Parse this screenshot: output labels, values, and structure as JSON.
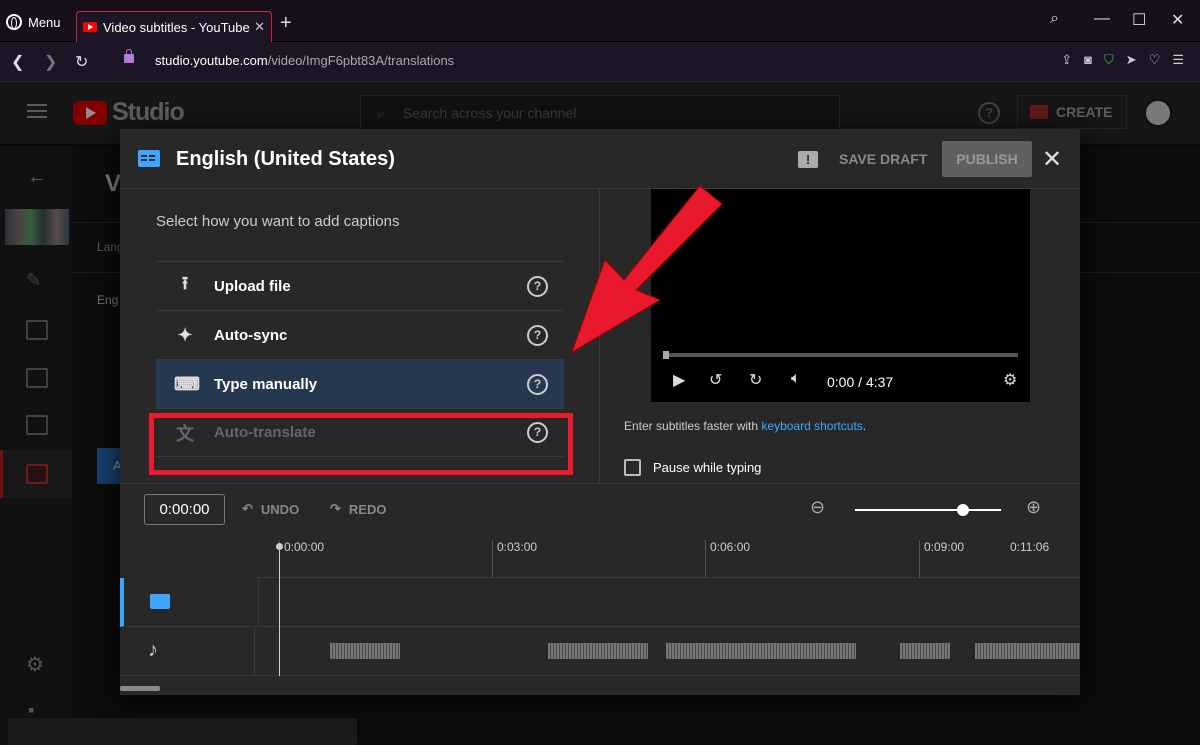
{
  "browser": {
    "menu_label": "Menu",
    "tab_title": "Video subtitles - YouTube Studio",
    "tab_close": "✕",
    "new_tab": "+",
    "url_host": "studio.youtube.com",
    "url_path": "/video/ImgF6pbt83A/translations"
  },
  "header": {
    "brand": "Studio",
    "search_placeholder": "Search across your channel",
    "help": "?",
    "create_label": "CREATE"
  },
  "background": {
    "page_title_partial": "V",
    "row1_partial": "Lang",
    "row2_partial": "Eng",
    "btn_partial": "A"
  },
  "dialog": {
    "title": "English (United States)",
    "save_draft": "SAVE DRAFT",
    "publish": "PUBLISH",
    "close": "✕",
    "prompt": "Select how you want to add captions",
    "options": [
      {
        "label": "Upload file",
        "icon": "upload-icon",
        "glyph": "⭱"
      },
      {
        "label": "Auto-sync",
        "icon": "sparkle-icon",
        "glyph": "✦"
      },
      {
        "label": "Type manually",
        "icon": "keyboard-icon",
        "glyph": "⌨"
      },
      {
        "label": "Auto-translate",
        "icon": "translate-icon",
        "glyph": "文"
      }
    ],
    "option_help": "?",
    "player": {
      "time": "0:00 / 4:37"
    },
    "shortcut_text": "Enter subtitles faster with ",
    "shortcut_link": "keyboard shortcuts",
    "shortcut_end": ".",
    "pause_label": "Pause while typing",
    "timeline": {
      "timecode": "0:00:00",
      "undo": "UNDO",
      "redo": "REDO",
      "ticks": [
        "0:00:00",
        "0:03:00",
        "0:06:00",
        "0:09:00",
        "0:11:06"
      ]
    }
  },
  "colors": {
    "accent": "#3ea6ff",
    "highlight_box": "#e8192c",
    "selected_option": "#263850",
    "youtube_red": "#ff0000"
  }
}
